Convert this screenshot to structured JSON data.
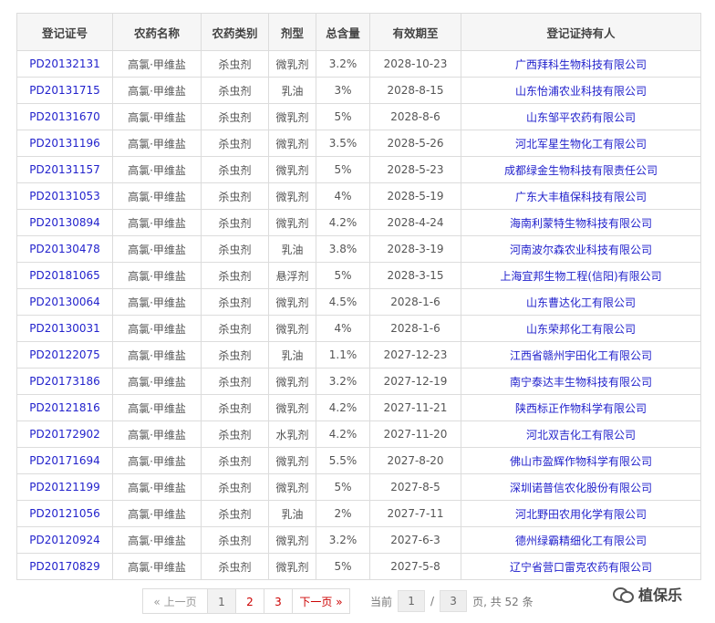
{
  "headers": [
    "登记证号",
    "农药名称",
    "农药类别",
    "剂型",
    "总含量",
    "有效期至",
    "登记证持有人"
  ],
  "rows": [
    [
      "PD20132131",
      "高氯·甲维盐",
      "杀虫剂",
      "微乳剂",
      "3.2%",
      "2028-10-23",
      "广西拜科生物科技有限公司"
    ],
    [
      "PD20131715",
      "高氯·甲维盐",
      "杀虫剂",
      "乳油",
      "3%",
      "2028-8-15",
      "山东怡浦农业科技有限公司"
    ],
    [
      "PD20131670",
      "高氯·甲维盐",
      "杀虫剂",
      "微乳剂",
      "5%",
      "2028-8-6",
      "山东邹平农药有限公司"
    ],
    [
      "PD20131196",
      "高氯·甲维盐",
      "杀虫剂",
      "微乳剂",
      "3.5%",
      "2028-5-26",
      "河北军星生物化工有限公司"
    ],
    [
      "PD20131157",
      "高氯·甲维盐",
      "杀虫剂",
      "微乳剂",
      "5%",
      "2028-5-23",
      "成都绿金生物科技有限责任公司"
    ],
    [
      "PD20131053",
      "高氯·甲维盐",
      "杀虫剂",
      "微乳剂",
      "4%",
      "2028-5-19",
      "广东大丰植保科技有限公司"
    ],
    [
      "PD20130894",
      "高氯·甲维盐",
      "杀虫剂",
      "微乳剂",
      "4.2%",
      "2028-4-24",
      "海南利蒙特生物科技有限公司"
    ],
    [
      "PD20130478",
      "高氯·甲维盐",
      "杀虫剂",
      "乳油",
      "3.8%",
      "2028-3-19",
      "河南波尔森农业科技有限公司"
    ],
    [
      "PD20181065",
      "高氯·甲维盐",
      "杀虫剂",
      "悬浮剂",
      "5%",
      "2028-3-15",
      "上海宜邦生物工程(信阳)有限公司"
    ],
    [
      "PD20130064",
      "高氯·甲维盐",
      "杀虫剂",
      "微乳剂",
      "4.5%",
      "2028-1-6",
      "山东曹达化工有限公司"
    ],
    [
      "PD20130031",
      "高氯·甲维盐",
      "杀虫剂",
      "微乳剂",
      "4%",
      "2028-1-6",
      "山东荣邦化工有限公司"
    ],
    [
      "PD20122075",
      "高氯·甲维盐",
      "杀虫剂",
      "乳油",
      "1.1%",
      "2027-12-23",
      "江西省赣州宇田化工有限公司"
    ],
    [
      "PD20173186",
      "高氯·甲维盐",
      "杀虫剂",
      "微乳剂",
      "3.2%",
      "2027-12-19",
      "南宁泰达丰生物科技有限公司"
    ],
    [
      "PD20121816",
      "高氯·甲维盐",
      "杀虫剂",
      "微乳剂",
      "4.2%",
      "2027-11-21",
      "陕西标正作物科学有限公司"
    ],
    [
      "PD20172902",
      "高氯·甲维盐",
      "杀虫剂",
      "水乳剂",
      "4.2%",
      "2027-11-20",
      "河北双吉化工有限公司"
    ],
    [
      "PD20171694",
      "高氯·甲维盐",
      "杀虫剂",
      "微乳剂",
      "5.5%",
      "2027-8-20",
      "佛山市盈辉作物科学有限公司"
    ],
    [
      "PD20121199",
      "高氯·甲维盐",
      "杀虫剂",
      "微乳剂",
      "5%",
      "2027-8-5",
      "深圳诺普信农化股份有限公司"
    ],
    [
      "PD20121056",
      "高氯·甲维盐",
      "杀虫剂",
      "乳油",
      "2%",
      "2027-7-11",
      "河北野田农用化学有限公司"
    ],
    [
      "PD20120924",
      "高氯·甲维盐",
      "杀虫剂",
      "微乳剂",
      "3.2%",
      "2027-6-3",
      "德州绿霸精细化工有限公司"
    ],
    [
      "PD20170829",
      "高氯·甲维盐",
      "杀虫剂",
      "微乳剂",
      "5%",
      "2027-5-8",
      "辽宁省营口雷克农药有限公司"
    ]
  ],
  "pagination": {
    "prev": "« 上一页",
    "pages": [
      "1",
      "2",
      "3"
    ],
    "current": "1",
    "next": "下一页 »",
    "current_label": "当前",
    "current_page": "1",
    "slash": "/",
    "total_pages": "3",
    "total_text": "页, 共 52 条"
  },
  "watermark": {
    "text": "植保乐",
    "icon": "wechat-icon"
  }
}
